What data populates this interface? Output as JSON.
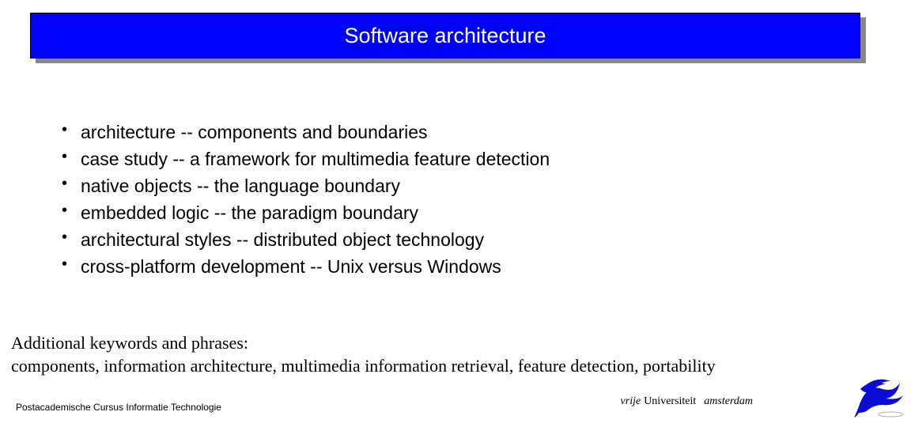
{
  "title": "Software architecture",
  "bullets": [
    "architecture -- components and boundaries",
    "case study -- a framework for multimedia feature detection",
    "native objects -- the language boundary",
    "embedded logic -- the paradigm boundary",
    "architectural styles -- distributed object technology",
    "cross-platform development -- Unix versus Windows"
  ],
  "additional_heading": "Additional keywords and phrases:",
  "additional_text": "components, information architecture, multimedia information retrieval, feature detection, portability",
  "footer_left": "Postacademische Cursus Informatie Technologie",
  "footer_right_italic1": "vrije",
  "footer_right_mid": "Universiteit",
  "footer_right_italic2": "amsterdam"
}
